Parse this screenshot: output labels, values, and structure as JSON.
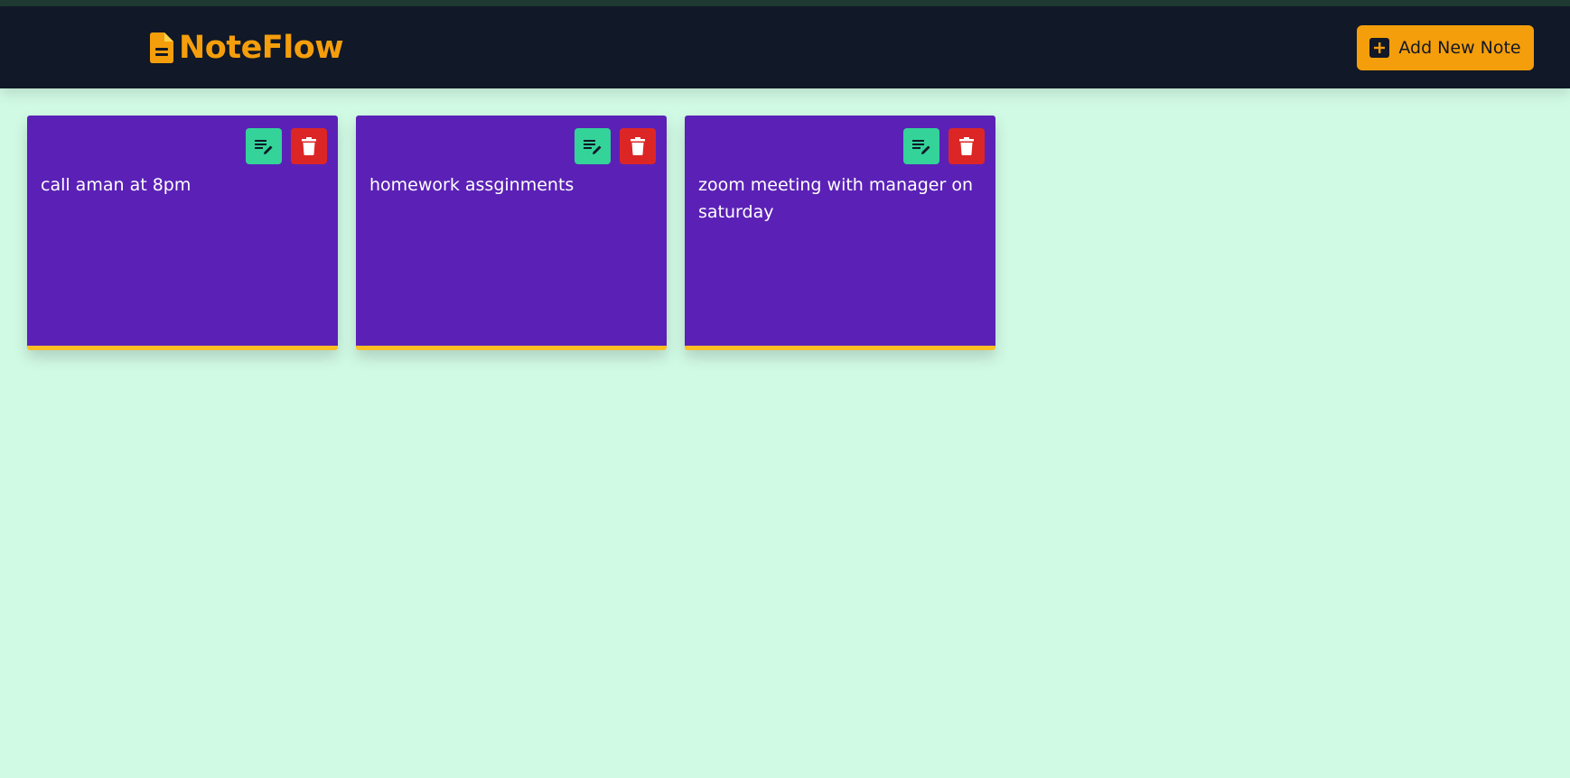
{
  "app": {
    "name": "NoteFlow",
    "brand_icon": "file-document-icon"
  },
  "header": {
    "add_button": {
      "label": "Add New Note",
      "icon": "plus-square-icon"
    }
  },
  "notes": [
    {
      "text": "call aman at 8pm",
      "edit_icon": "edit-note-icon",
      "delete_icon": "trash-icon"
    },
    {
      "text": "homework assginments",
      "edit_icon": "edit-note-icon",
      "delete_icon": "trash-icon"
    },
    {
      "text": "zoom meeting with manager on saturday",
      "edit_icon": "edit-note-icon",
      "delete_icon": "trash-icon"
    }
  ],
  "colors": {
    "background": "#d1fae5",
    "navbar": "#111827",
    "accent": "#f59e0b",
    "note_background": "#5b21b6",
    "note_border": "#fbbf24",
    "edit_button": "#34d399",
    "delete_button": "#dc2626"
  }
}
